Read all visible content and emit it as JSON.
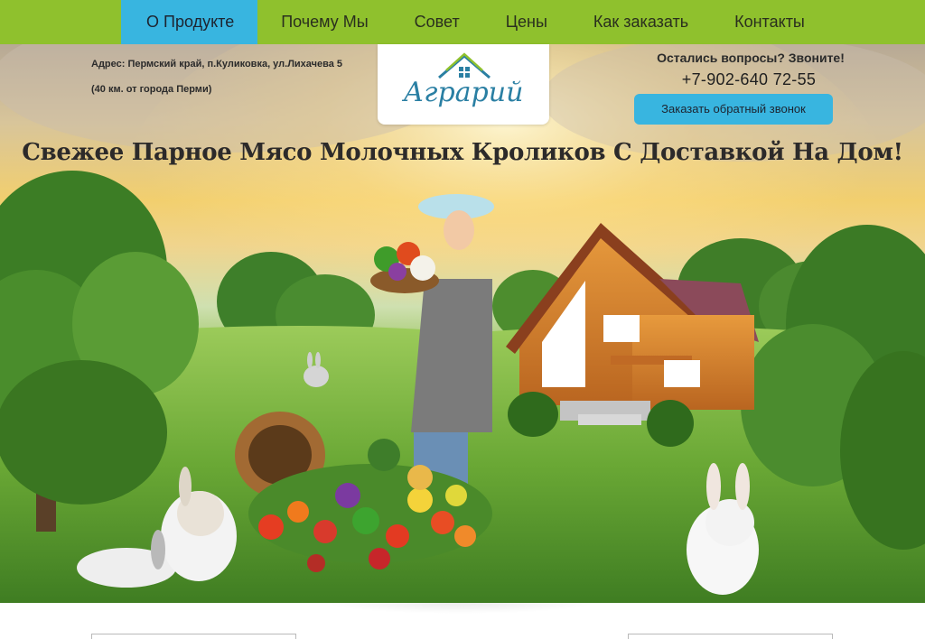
{
  "nav": {
    "items": [
      {
        "label": "О Продукте",
        "active": true
      },
      {
        "label": "Почему Мы",
        "active": false
      },
      {
        "label": "Совет",
        "active": false
      },
      {
        "label": "Цены",
        "active": false
      },
      {
        "label": "Как заказать",
        "active": false
      },
      {
        "label": "Контакты",
        "active": false
      }
    ]
  },
  "header": {
    "address_line1": "Адрес: Пермский край, п.Куликовка, ул.Лихачева 5",
    "address_line2": "(40 км. от города Перми)",
    "logo_text": "Аграрий",
    "contact_question": "Остались вопросы? Звоните!",
    "phone": "+7-902-640 72-55",
    "callback_label": "Заказать обратный звонок"
  },
  "hero": {
    "headline": "Свежее Парное Мясо Молочных Кроликов С Доставкой На Дом!"
  },
  "colors": {
    "nav_green": "#8fc12d",
    "accent_blue": "#38b5e0",
    "logo_blue": "#2a7fa3"
  }
}
